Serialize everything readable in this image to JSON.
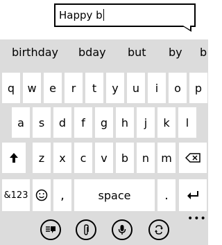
{
  "input": {
    "value": "Happy b"
  },
  "suggestions": [
    "birthday",
    "bday",
    "but",
    "by",
    "b"
  ],
  "keyboard": {
    "row1": [
      "q",
      "w",
      "e",
      "r",
      "t",
      "y",
      "u",
      "i",
      "o",
      "p"
    ],
    "row2": [
      "a",
      "s",
      "d",
      "f",
      "g",
      "h",
      "j",
      "k",
      "l"
    ],
    "row3": [
      "z",
      "x",
      "c",
      "v",
      "b",
      "n",
      "m"
    ],
    "symbols_label": "&123",
    "comma_label": ",",
    "space_label": "space",
    "period_label": "."
  },
  "icons": {
    "shift": "shift-arrow-icon",
    "backspace": "backspace-icon",
    "emoji": "smiley-icon",
    "enter": "enter-icon",
    "text_mode": "text-input-mode-icon",
    "attach": "paperclip-icon",
    "voice": "microphone-icon",
    "switch": "switch-arrows-icon",
    "more": "more-dots-icon"
  },
  "more_label": "•••"
}
